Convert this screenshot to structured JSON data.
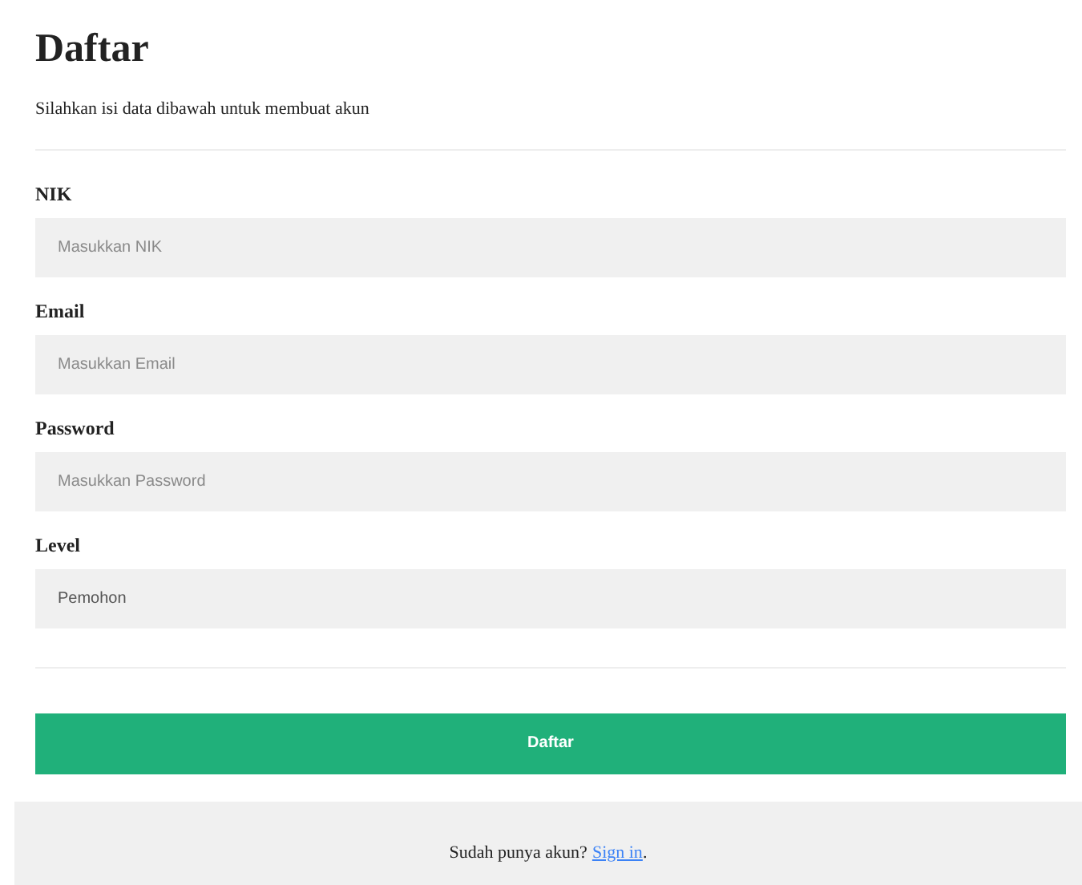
{
  "title": "Daftar",
  "subtitle": "Silahkan isi data dibawah untuk membuat akun",
  "fields": [
    {
      "label": "NIK",
      "placeholder": "Masukkan NIK"
    },
    {
      "label": "Email",
      "placeholder": "Masukkan Email"
    },
    {
      "label": "Password",
      "placeholder": "Masukkan Password"
    },
    {
      "label": "Level",
      "value": "Pemohon"
    }
  ],
  "submit_button": "Daftar",
  "footer": {
    "text": "Sudah punya akun?",
    "link": "Sign in",
    "suffix": "."
  }
}
